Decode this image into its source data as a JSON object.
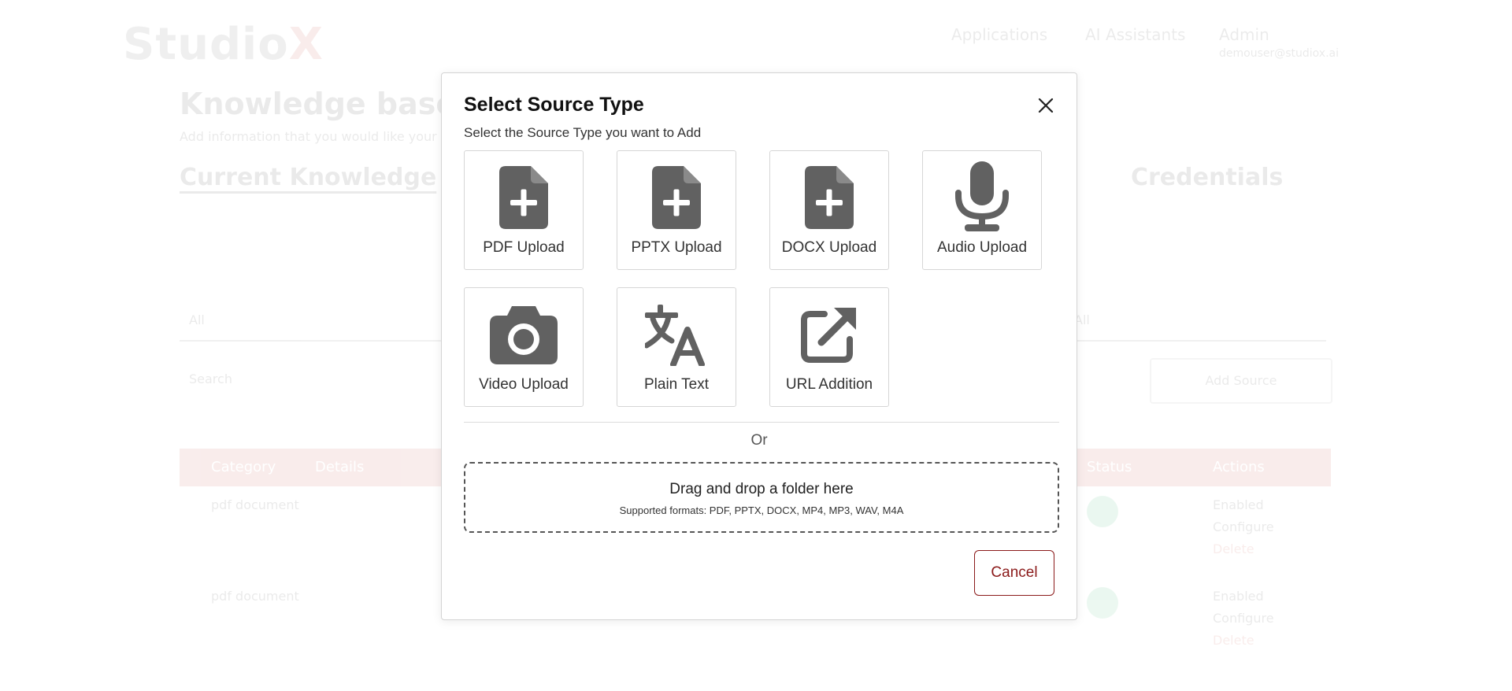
{
  "background": {
    "logo_main": "StudioX",
    "logo_accent": "X",
    "nav": [
      "Applications",
      "AI Assistants",
      "Admin"
    ],
    "nav_sub": "demouser@studiox.ai",
    "page_title": "Knowledge base",
    "page_subtitle": "Add information that you would like your assistants to use",
    "tabs": [
      "Current Knowledge",
      "Credentials"
    ],
    "search_placeholder": "Search",
    "add_source_label": "Add Source",
    "select_value": "All",
    "table_header": [
      "Category",
      "Details",
      "Status",
      "Actions"
    ],
    "row_category": "pdf document",
    "row_actions": [
      "Enabled",
      "Configure",
      "Delete"
    ]
  },
  "modal": {
    "title": "Select Source Type",
    "subtitle": "Select the Source Type you want to Add",
    "close_icon": "close-icon",
    "tiles": [
      {
        "label": "PDF Upload",
        "icon": "file-plus-icon"
      },
      {
        "label": "PPTX Upload",
        "icon": "file-plus-icon"
      },
      {
        "label": "DOCX Upload",
        "icon": "file-plus-icon"
      },
      {
        "label": "Audio Upload",
        "icon": "microphone-icon"
      },
      {
        "label": "Video Upload",
        "icon": "camera-icon"
      },
      {
        "label": "Plain Text",
        "icon": "translate-icon"
      },
      {
        "label": "URL Addition",
        "icon": "external-link-icon"
      }
    ],
    "or_text": "Or",
    "dropzone_title": "Drag and drop a folder here",
    "dropzone_formats": "Supported formats: PDF, PPTX, DOCX, MP4, MP3, WAV, M4A",
    "cancel_label": "Cancel"
  },
  "colors": {
    "icon": "#616161",
    "accent": "#8b1a1a",
    "table_header_bg": "#c0392b"
  }
}
